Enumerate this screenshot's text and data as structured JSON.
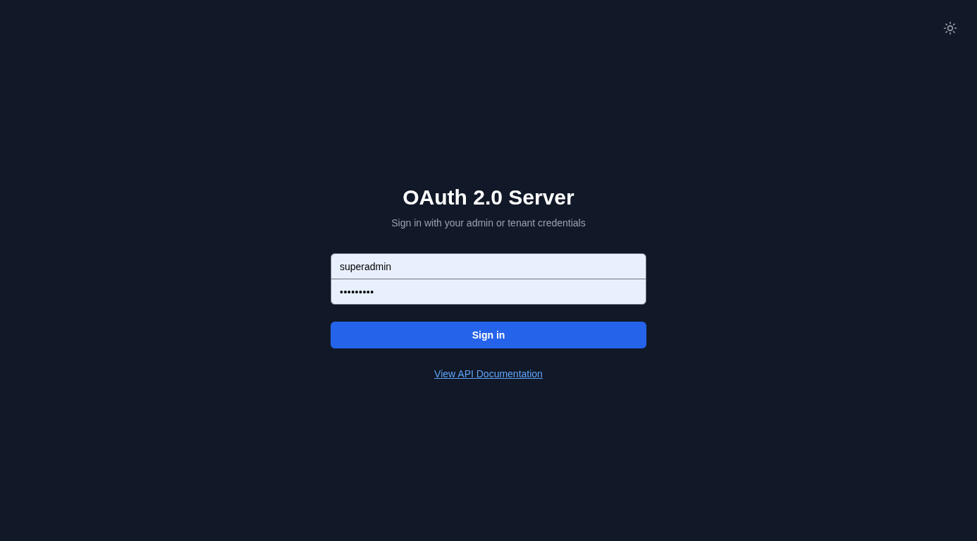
{
  "title": "OAuth 2.0 Server",
  "subtitle": "Sign in with your admin or tenant credentials",
  "fields": [
    {
      "kind": "text",
      "value": "superadmin"
    },
    {
      "kind": "password",
      "value": "•••••••••"
    }
  ],
  "submit_button": "Sign in",
  "docs_link": "View API Documentation"
}
